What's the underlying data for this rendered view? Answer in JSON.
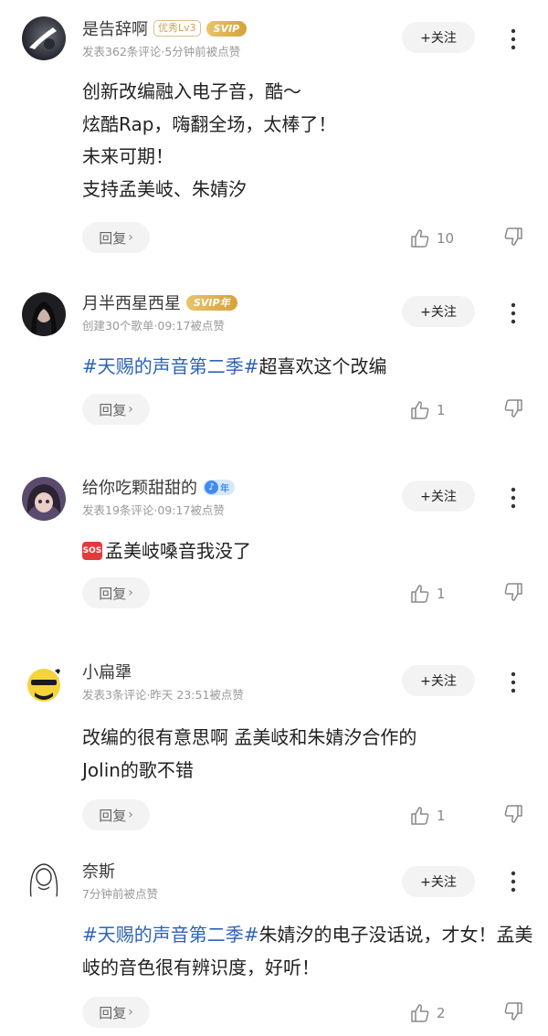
{
  "comments": [
    {
      "username": "是告辞啊",
      "level_badge": "优秀Lv3",
      "svip_badge": "SVIP",
      "meta": "发表362条评论·5分钟前被点赞",
      "follow_label": "+关注",
      "lines": [
        "创新改编融入电子音，酷～",
        "炫酷Rap，嗨翻全场，太棒了！",
        "未来可期！",
        "支持孟美岐、朱婧汐"
      ],
      "reply_label": "回复",
      "like_count": "10",
      "avatar": "avatar-dark-moon"
    },
    {
      "username": "月半西星西星",
      "svip_badge": "SVIP年",
      "meta": "创建30个歌单·09:17被点赞",
      "follow_label": "+关注",
      "hashtag": "#天赐的声音第二季#",
      "text": "超喜欢这个改编",
      "reply_label": "回复",
      "like_count": "1",
      "avatar": "avatar-woman-portrait"
    },
    {
      "username": "给你吃颗甜甜的",
      "note_badge": "年",
      "meta": "发表19条评论·09:17被点赞",
      "follow_label": "+关注",
      "sos_emoji": "SOS",
      "text": "孟美岐嗓音我没了",
      "reply_label": "回复",
      "like_count": "1",
      "avatar": "avatar-anime-girl"
    },
    {
      "username": "小扁犟",
      "meta": "发表3条评论·昨天 23:51被点赞",
      "follow_label": "+关注",
      "lines": [
        "改编的很有意思啊 孟美岐和朱婧汐合作的",
        "Jolin的歌不错"
      ],
      "reply_label": "回复",
      "like_count": "1",
      "avatar": "avatar-yellow-emoji"
    },
    {
      "username": "奈斯",
      "meta": "7分钟前被点赞",
      "follow_label": "+关注",
      "hashtag": "#天赐的声音第二季#",
      "text": "朱婧汐的电子没话说，才女！孟美岐的音色很有辨识度，好听！",
      "reply_label": "回复",
      "like_count": "2",
      "avatar": "avatar-line-hoodie"
    }
  ],
  "colors": {
    "hashtag": "#2d63b7",
    "svip_gold": "#d4a23a",
    "note_badge": "#3f8cf0"
  }
}
